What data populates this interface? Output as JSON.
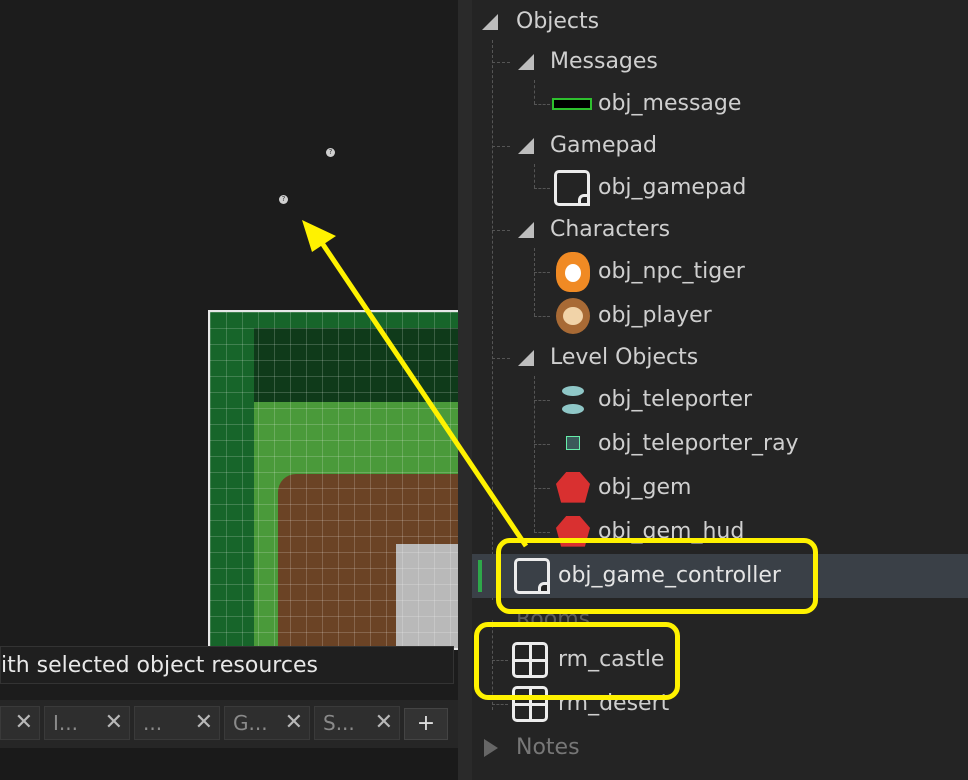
{
  "room_editor": {
    "status_text": "ith selected object resources",
    "tabs": [
      {
        "label": "",
        "close": "✕"
      },
      {
        "label": "I...",
        "close": "✕"
      },
      {
        "label": "...",
        "close": "✕"
      },
      {
        "label": "G...",
        "close": "✕"
      },
      {
        "label": "S...",
        "close": "✕"
      }
    ],
    "add_tab_label": "+",
    "instance_marker": "?"
  },
  "asset_browser": {
    "root_group": "Objects",
    "groups": [
      {
        "name": "Messages",
        "items": [
          {
            "name": "obj_message",
            "icon": "message-sprite-icon"
          }
        ]
      },
      {
        "name": "Gamepad",
        "items": [
          {
            "name": "obj_gamepad",
            "icon": "object-icon"
          }
        ]
      },
      {
        "name": "Characters",
        "items": [
          {
            "name": "obj_npc_tiger",
            "icon": "tiger-sprite-icon"
          },
          {
            "name": "obj_player",
            "icon": "monkey-sprite-icon"
          }
        ]
      },
      {
        "name": "Level Objects",
        "items": [
          {
            "name": "obj_teleporter",
            "icon": "teleporter-sprite-icon"
          },
          {
            "name": "obj_teleporter_ray",
            "icon": "teleporter-ray-sprite-icon"
          },
          {
            "name": "obj_gem",
            "icon": "gem-sprite-icon"
          },
          {
            "name": "obj_gem_hud",
            "icon": "gem-sprite-icon"
          }
        ]
      }
    ],
    "selected_item": "obj_game_controller",
    "rooms_group": "Rooms",
    "rooms": [
      "rm_castle",
      "rm_desert"
    ],
    "notes_group": "Notes"
  },
  "annotation": {
    "color": "#fff200"
  }
}
